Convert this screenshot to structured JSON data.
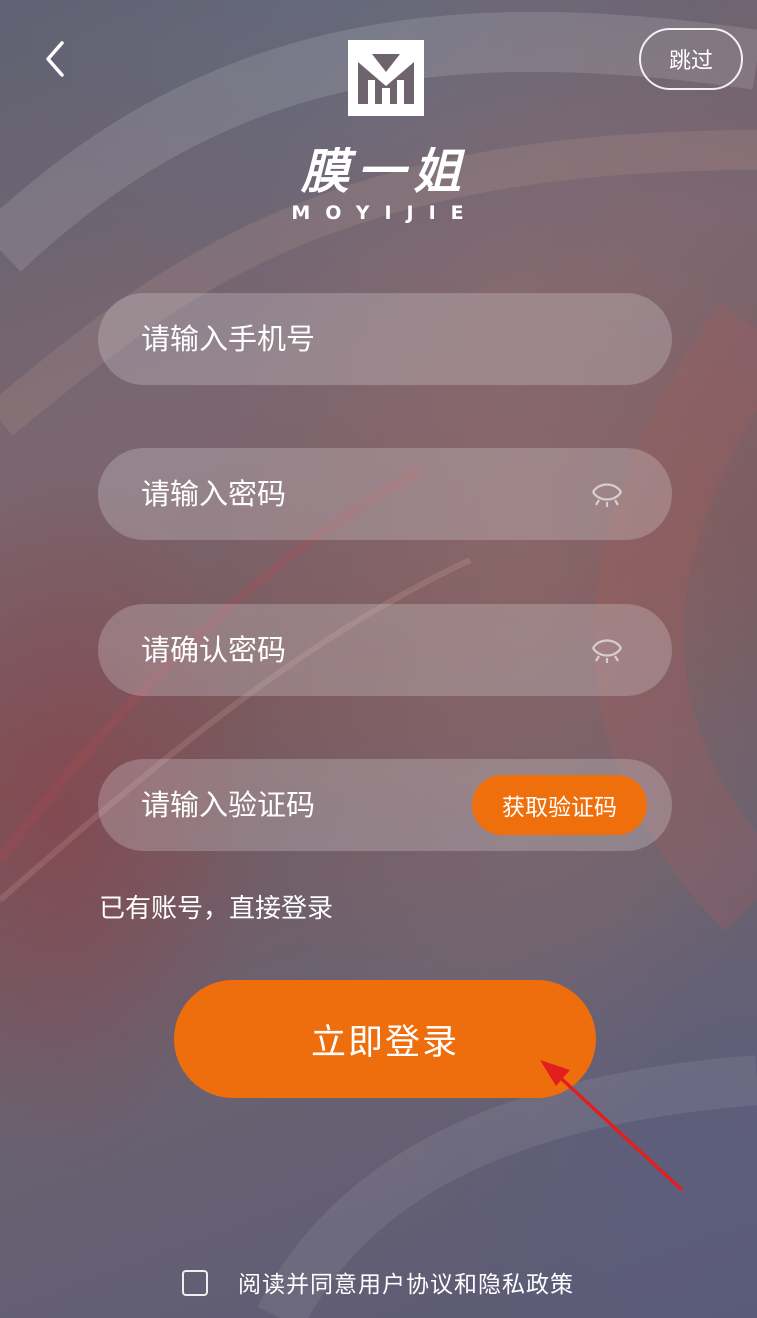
{
  "header": {
    "skip_label": "跳过",
    "brand_name": "膜一姐",
    "brand_sub": "MOYIJIE"
  },
  "form": {
    "phone_placeholder": "请输入手机号",
    "password_placeholder": "请输入密码",
    "confirm_placeholder": "请确认密码",
    "code_placeholder": "请输入验证码",
    "get_code_label": "获取验证码"
  },
  "login_link": "已有账号，直接登录",
  "login_button": "立即登录",
  "agreement": {
    "checked": false,
    "text": "阅读并同意用户协议和隐私政策"
  },
  "icons": {
    "back": "chevron-left-icon",
    "logo": "logo-icon",
    "password_eye": "eye-closed-icon",
    "arrow": "annotation-arrow-icon"
  },
  "colors": {
    "accent": "#ee6e0d",
    "arrow": "#e21f1f"
  }
}
